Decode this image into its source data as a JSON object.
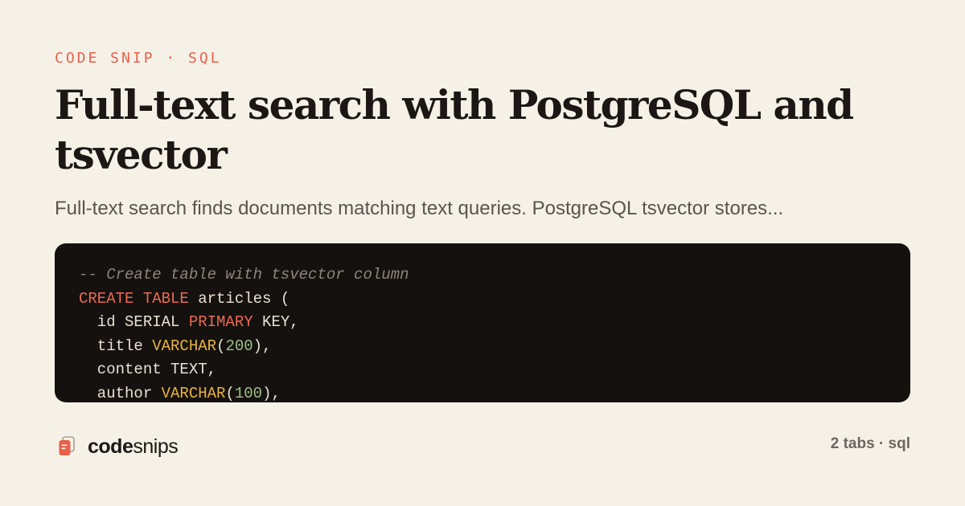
{
  "header": {
    "eyebrow": "CODE SNIP · SQL",
    "title": "Full-text search with PostgreSQL and tsvector",
    "description": "Full-text search finds documents matching text queries. PostgreSQL tsvector stores..."
  },
  "code": {
    "language": "sql",
    "lines": [
      [
        {
          "t": "comment",
          "v": "-- Create table with tsvector column"
        }
      ],
      [
        {
          "t": "keyword",
          "v": "CREATE TABLE"
        },
        {
          "t": "plain",
          "v": " articles ("
        }
      ],
      [
        {
          "t": "plain",
          "v": "  id SERIAL "
        },
        {
          "t": "keyword",
          "v": "PRIMARY"
        },
        {
          "t": "plain",
          "v": " KEY,"
        }
      ],
      [
        {
          "t": "plain",
          "v": "  title "
        },
        {
          "t": "type",
          "v": "VARCHAR"
        },
        {
          "t": "plain",
          "v": "("
        },
        {
          "t": "number",
          "v": "200"
        },
        {
          "t": "plain",
          "v": "),"
        }
      ],
      [
        {
          "t": "plain",
          "v": "  content TEXT,"
        }
      ],
      [
        {
          "t": "plain",
          "v": "  author "
        },
        {
          "t": "type",
          "v": "VARCHAR"
        },
        {
          "t": "plain",
          "v": "("
        },
        {
          "t": "number",
          "v": "100"
        },
        {
          "t": "plain",
          "v": "),"
        }
      ]
    ]
  },
  "footer": {
    "brand_icon": "code-file-icon",
    "brand_bold": "code",
    "brand_rest": "snips",
    "meta": "2 tabs · sql"
  },
  "colors": {
    "background": "#f6f1e7",
    "accent": "#e8604c",
    "code_background": "#15110e",
    "keyword": "#ec6a55",
    "type": "#e7b246",
    "number": "#9ec08d",
    "comment": "#8d857c"
  }
}
